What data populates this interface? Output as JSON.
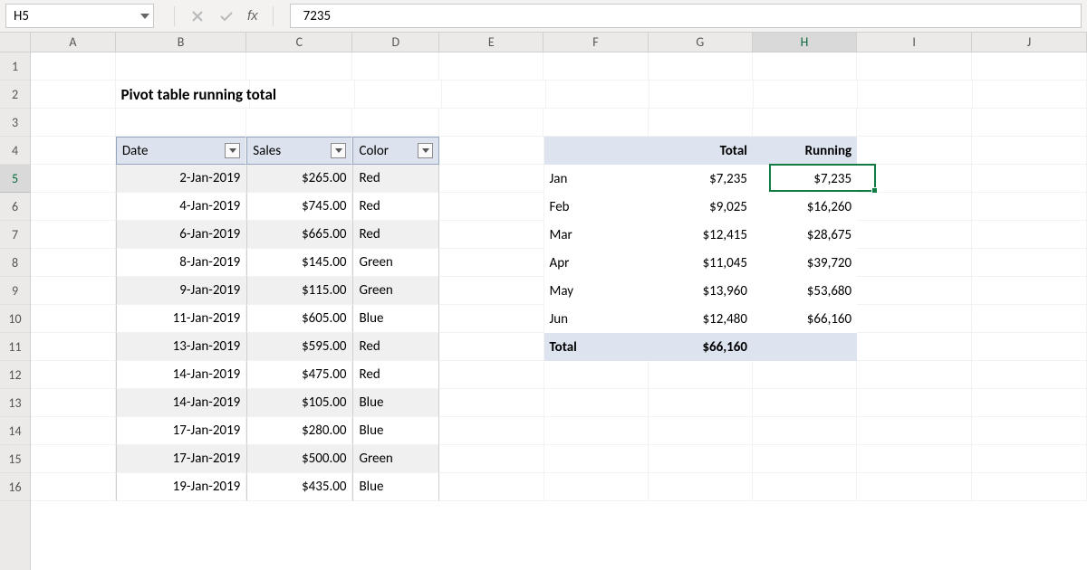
{
  "formula_bar": {
    "name_box": "H5",
    "fx_label": "fx",
    "value": "7235"
  },
  "columns": [
    "A",
    "B",
    "C",
    "D",
    "E",
    "F",
    "G",
    "H",
    "I",
    "J"
  ],
  "rows": [
    "1",
    "2",
    "3",
    "4",
    "5",
    "6",
    "7",
    "8",
    "9",
    "10",
    "11",
    "12",
    "13",
    "14",
    "15",
    "16"
  ],
  "selected_col": "H",
  "selected_row": "5",
  "title": "Pivot table running total",
  "table_headers": {
    "date": "Date",
    "sales": "Sales",
    "color": "Color"
  },
  "table_rows": [
    {
      "date": "2-Jan-2019",
      "sales": "$265.00",
      "color": "Red"
    },
    {
      "date": "4-Jan-2019",
      "sales": "$745.00",
      "color": "Red"
    },
    {
      "date": "6-Jan-2019",
      "sales": "$665.00",
      "color": "Red"
    },
    {
      "date": "8-Jan-2019",
      "sales": "$145.00",
      "color": "Green"
    },
    {
      "date": "9-Jan-2019",
      "sales": "$115.00",
      "color": "Green"
    },
    {
      "date": "11-Jan-2019",
      "sales": "$605.00",
      "color": "Blue"
    },
    {
      "date": "13-Jan-2019",
      "sales": "$595.00",
      "color": "Red"
    },
    {
      "date": "14-Jan-2019",
      "sales": "$475.00",
      "color": "Red"
    },
    {
      "date": "14-Jan-2019",
      "sales": "$105.00",
      "color": "Blue"
    },
    {
      "date": "17-Jan-2019",
      "sales": "$280.00",
      "color": "Blue"
    },
    {
      "date": "17-Jan-2019",
      "sales": "$500.00",
      "color": "Green"
    },
    {
      "date": "19-Jan-2019",
      "sales": "$435.00",
      "color": "Blue"
    }
  ],
  "pivot_headers": {
    "col1": "",
    "col2": "Total",
    "col3": "Running"
  },
  "pivot_rows": [
    {
      "m": "Jan",
      "t": "$7,235",
      "r": "$7,235"
    },
    {
      "m": "Feb",
      "t": "$9,025",
      "r": "$16,260"
    },
    {
      "m": "Mar",
      "t": "$12,415",
      "r": "$28,675"
    },
    {
      "m": "Apr",
      "t": "$11,045",
      "r": "$39,720"
    },
    {
      "m": "May",
      "t": "$13,960",
      "r": "$53,680"
    },
    {
      "m": "Jun",
      "t": "$12,480",
      "r": "$66,160"
    }
  ],
  "pivot_total": {
    "label": "Total",
    "value": "$66,160"
  },
  "icons": {
    "dropdown": "▼",
    "x": "✕",
    "check": "✓"
  }
}
